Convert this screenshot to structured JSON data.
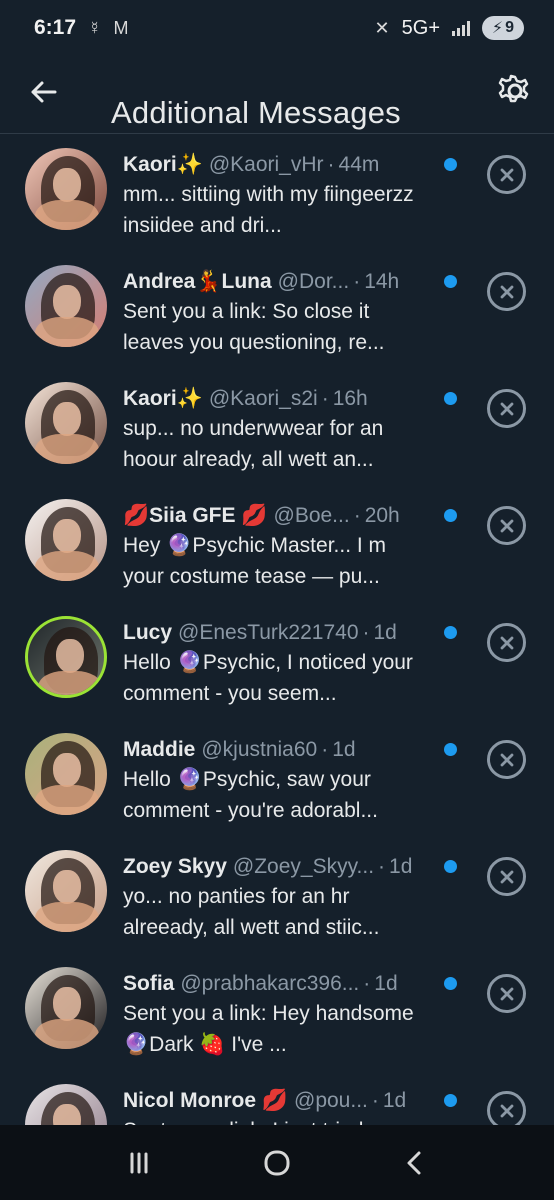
{
  "status_bar": {
    "time": "6:17",
    "left_icons": [
      "mercury-symbol-icon",
      "gmail-icon"
    ],
    "network": "5G+",
    "battery": "9"
  },
  "header": {
    "title": "Additional Messages",
    "back_icon": "arrow-left-icon",
    "settings_icon": "gear-icon"
  },
  "colors": {
    "background": "#15202b",
    "accent_blue": "#1d9bf0",
    "secondary_text": "#8b98a5",
    "highlight_ring": "#9be335"
  },
  "messages": [
    {
      "name": "Kaori✨",
      "handle": "@Kaori_vHr",
      "time": "44m",
      "preview": "mm... sittiing with my fiingeerzz insiidee and dri...",
      "unread": true
    },
    {
      "name": "Andrea💃Luna",
      "handle": "@Dor...",
      "time": "14h",
      "preview": "Sent you a link: So close it leaves you questioning, re...",
      "unread": true
    },
    {
      "name": "Kaori✨",
      "handle": "@Kaori_s2i",
      "time": "16h",
      "preview": "sup... no underwwear for an hoour already, all wett an...",
      "unread": true
    },
    {
      "name": "💋Siia GFE 💋",
      "handle": "@Boe...",
      "time": "20h",
      "preview": "Hey 🔮Psychic  Master... I m your costume tease — pu...",
      "unread": true
    },
    {
      "name": "Lucy",
      "handle": "@EnesTurk221740",
      "time": "1d",
      "preview": "Hello 🔮Psychic, I noticed your comment - you seem...",
      "unread": true
    },
    {
      "name": "Maddie",
      "handle": "@kjustnia60",
      "time": "1d",
      "preview": "Hello 🔮Psychic, saw your comment - you're adorabl...",
      "unread": true
    },
    {
      "name": "Zoey Skyy",
      "handle": "@Zoey_Skyy...",
      "time": "1d",
      "preview": "yo... no panties for an hr alreeady, all wett and stiic...",
      "unread": true
    },
    {
      "name": "Sofia",
      "handle": "@prabhakarc396...",
      "time": "1d",
      "preview": "Sent you a link: Hey handsome 🔮Dark 🍓 I've ...",
      "unread": true
    },
    {
      "name": "Nicol Monroe 💋",
      "handle": "@pou...",
      "time": "1d",
      "preview": "Sent you a link: I just tried...",
      "unread": true
    }
  ],
  "navigation": {
    "recent_apps_icon": "recent-apps-icon",
    "home_icon": "home-icon",
    "back_icon": "android-back-icon"
  }
}
